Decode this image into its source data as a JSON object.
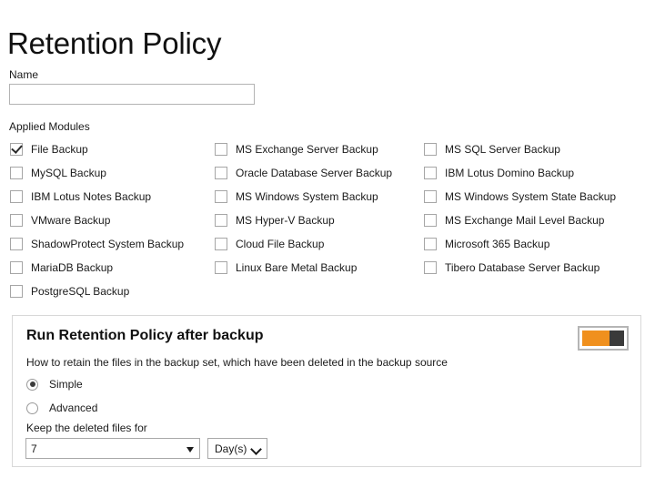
{
  "page_title": "Retention Policy",
  "name_field": {
    "label": "Name",
    "value": "",
    "placeholder": ""
  },
  "applied_modules": {
    "label": "Applied Modules",
    "columns": [
      [
        {
          "label": "File Backup",
          "checked": true
        },
        {
          "label": "MySQL Backup",
          "checked": false
        },
        {
          "label": "IBM Lotus Notes Backup",
          "checked": false
        },
        {
          "label": "VMware Backup",
          "checked": false
        },
        {
          "label": "ShadowProtect System Backup",
          "checked": false
        },
        {
          "label": "MariaDB Backup",
          "checked": false
        },
        {
          "label": "PostgreSQL Backup",
          "checked": false
        }
      ],
      [
        {
          "label": "MS Exchange Server Backup",
          "checked": false
        },
        {
          "label": "Oracle Database Server Backup",
          "checked": false
        },
        {
          "label": "MS Windows System Backup",
          "checked": false
        },
        {
          "label": "MS Hyper-V Backup",
          "checked": false
        },
        {
          "label": "Cloud File Backup",
          "checked": false
        },
        {
          "label": "Linux Bare Metal Backup",
          "checked": false
        }
      ],
      [
        {
          "label": "MS SQL Server Backup",
          "checked": false
        },
        {
          "label": "IBM Lotus Domino Backup",
          "checked": false
        },
        {
          "label": "MS Windows System State Backup",
          "checked": false
        },
        {
          "label": "MS Exchange Mail Level Backup",
          "checked": false
        },
        {
          "label": "Microsoft 365 Backup",
          "checked": false
        },
        {
          "label": "Tibero Database Server Backup",
          "checked": false
        }
      ]
    ]
  },
  "panel": {
    "heading": "Run Retention Policy after backup",
    "description": "How to retain the files in the backup set, which have been deleted in the backup source",
    "toggle": {
      "state": "on",
      "track_color": "#F0901E",
      "knob_color": "#3A3A3A",
      "border_color": "#B5B5B5"
    },
    "radios": [
      {
        "label": "Simple",
        "selected": true
      },
      {
        "label": "Advanced",
        "selected": false
      }
    ],
    "keep_label": "Keep the deleted files for",
    "keep_value": "7",
    "keep_unit": "Day(s)"
  }
}
